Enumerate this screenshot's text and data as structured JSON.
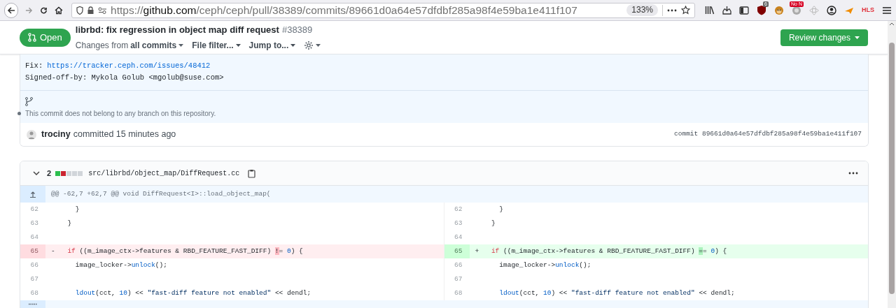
{
  "browser": {
    "url": {
      "scheme": "https://",
      "domain": "github.com",
      "path": "/ceph/ceph/pull/38389/commits/89661d0a64e57dfdbf285a98f4e59ba1e411f107"
    },
    "zoom": "133%",
    "extension_badges": [
      "6",
      "No N"
    ],
    "extension_label": "HLS"
  },
  "pull_request": {
    "state": "Open",
    "title": "librbd: fix regression in object map diff request",
    "number": "#38389",
    "changes_from_label": "Changes from",
    "changes_from_value": "all commits",
    "file_filter": "File filter...",
    "jump_to": "Jump to...",
    "review_button": "Review changes"
  },
  "commit": {
    "fix_label": "Fix:",
    "fix_link": "https://tracker.ceph.com/issues/48412",
    "signed_off": "Signed-off-by: Mykola Golub <mgolub@suse.com>",
    "branch_note": "This commit does not belong to any branch on this repository.",
    "author": "trociny",
    "action": "committed 15 minutes ago",
    "sha_label": "commit",
    "sha": "89661d0a64e57dfdbf285a98f4e59ba1e411f107"
  },
  "file": {
    "changes": "2",
    "diffstat": [
      {
        "kind": "added"
      },
      {
        "kind": "deleted"
      },
      {
        "kind": "neutral"
      },
      {
        "kind": "neutral"
      },
      {
        "kind": "neutral"
      }
    ],
    "path": "src/librbd/object_map/DiffRequest.cc",
    "hunk_header": "@@ -62,7 +62,7 @@ void DiffRequest<I>::load_object_map(",
    "left": [
      {
        "number": "62",
        "kind": "context",
        "tokens": [
          {
            "text": "    }",
            "kind": "plain"
          }
        ]
      },
      {
        "number": "63",
        "kind": "context",
        "tokens": [
          {
            "text": "  }",
            "kind": "plain"
          }
        ]
      },
      {
        "number": "64",
        "kind": "context"
      },
      {
        "number": "65",
        "kind": "deletion",
        "marker": "-",
        "tokens": [
          {
            "text": "  if",
            "kind": "keyword"
          },
          {
            "text": " ((m_image_ctx->features & RBD_FEATURE_FAST_DIFF) ",
            "kind": "plain"
          },
          {
            "text": "!",
            "kind": "changed"
          },
          {
            "text": "= ",
            "kind": "plain"
          },
          {
            "text": "0",
            "kind": "number"
          },
          {
            "text": ") {",
            "kind": "plain"
          }
        ]
      },
      {
        "number": "66",
        "kind": "context",
        "tokens": [
          {
            "text": "    image_locker->",
            "kind": "plain"
          },
          {
            "text": "unlock",
            "kind": "function"
          },
          {
            "text": "();",
            "kind": "plain"
          }
        ]
      },
      {
        "number": "67",
        "kind": "context"
      },
      {
        "number": "68",
        "kind": "context",
        "tokens": [
          {
            "text": "    ldout",
            "kind": "function"
          },
          {
            "text": "(cct, ",
            "kind": "plain"
          },
          {
            "text": "10",
            "kind": "number"
          },
          {
            "text": ") << ",
            "kind": "plain"
          },
          {
            "text": "\"fast-diff feature not enabled\"",
            "kind": "string"
          },
          {
            "text": " << dendl;",
            "kind": "plain"
          }
        ]
      }
    ],
    "right": [
      {
        "number": "62",
        "kind": "context",
        "tokens": [
          {
            "text": "    }",
            "kind": "plain"
          }
        ]
      },
      {
        "number": "63",
        "kind": "context",
        "tokens": [
          {
            "text": "  }",
            "kind": "plain"
          }
        ]
      },
      {
        "number": "64",
        "kind": "context"
      },
      {
        "number": "65",
        "kind": "addition",
        "marker": "+",
        "tokens": [
          {
            "text": "  if",
            "kind": "keyword"
          },
          {
            "text": " ((m_image_ctx->features & RBD_FEATURE_FAST_DIFF) ",
            "kind": "plain"
          },
          {
            "text": "=",
            "kind": "changed"
          },
          {
            "text": "= ",
            "kind": "plain"
          },
          {
            "text": "0",
            "kind": "number"
          },
          {
            "text": ") {",
            "kind": "plain"
          }
        ]
      },
      {
        "number": "66",
        "kind": "context",
        "tokens": [
          {
            "text": "    image_locker->",
            "kind": "plain"
          },
          {
            "text": "unlock",
            "kind": "function"
          },
          {
            "text": "();",
            "kind": "plain"
          }
        ]
      },
      {
        "number": "67",
        "kind": "context"
      },
      {
        "number": "68",
        "kind": "context",
        "tokens": [
          {
            "text": "    ldout",
            "kind": "function"
          },
          {
            "text": "(cct, ",
            "kind": "plain"
          },
          {
            "text": "10",
            "kind": "number"
          },
          {
            "text": ") << ",
            "kind": "plain"
          },
          {
            "text": "\"fast-diff feature not enabled\"",
            "kind": "string"
          },
          {
            "text": " << dendl;",
            "kind": "plain"
          }
        ]
      }
    ]
  }
}
